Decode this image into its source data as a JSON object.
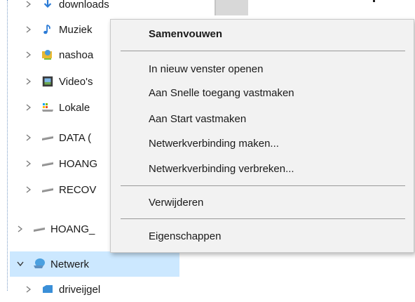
{
  "nav": {
    "items": [
      {
        "label": "downloads",
        "icon": "downloads-icon"
      },
      {
        "label": "Muziek",
        "icon": "music-icon"
      },
      {
        "label": "nashoa",
        "icon": "network-user-folder-icon"
      },
      {
        "label": "Video's",
        "icon": "video-icon"
      },
      {
        "label": "Lokale",
        "icon": "local-disk-icon"
      },
      {
        "label": "DATA (",
        "icon": "drive-icon"
      },
      {
        "label": "HOANG",
        "icon": "drive-icon"
      },
      {
        "label": "RECOV",
        "icon": "drive-icon"
      },
      {
        "label": "HOANG_",
        "icon": "drive-icon"
      },
      {
        "label": "Netwerk",
        "icon": "network-icon",
        "selected": true
      },
      {
        "label": "driveijgel",
        "icon": "network-folder-icon"
      }
    ]
  },
  "context_menu": {
    "items": [
      {
        "label": "Samenvouwen",
        "bold": true
      },
      {
        "label": "In nieuw venster openen"
      },
      {
        "label": "Aan Snelle toegang vastmaken"
      },
      {
        "label": "Aan Start vastmaken"
      },
      {
        "label": "Netwerkverbinding maken..."
      },
      {
        "label": "Netwerkverbinding verbreken..."
      },
      {
        "label": "Verwijderen"
      },
      {
        "label": "Eigenschappen"
      }
    ]
  },
  "colors": {
    "selection": "#cce8ff",
    "menu_bg": "#f2f2f2",
    "separator": "#999999"
  }
}
